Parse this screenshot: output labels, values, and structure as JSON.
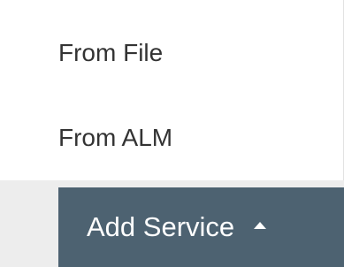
{
  "menu": {
    "items": [
      {
        "label": "From File"
      },
      {
        "label": "From ALM"
      }
    ]
  },
  "button": {
    "label": "Add Service",
    "icon": "caret-up-icon"
  },
  "colors": {
    "menu_background": "#ffffff",
    "page_background": "#ededed",
    "button_background": "#4d6271",
    "button_text": "#ffffff",
    "menu_text": "#333333"
  }
}
